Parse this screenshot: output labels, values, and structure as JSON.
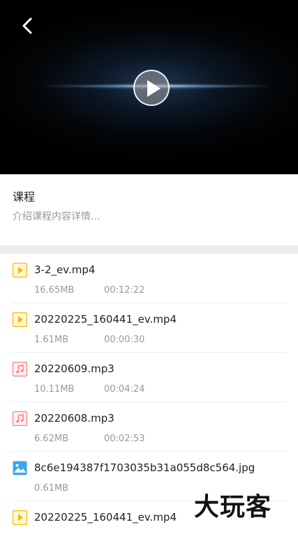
{
  "player": {
    "back_icon": "chevron-left-icon",
    "play_icon": "play-icon"
  },
  "course": {
    "title": "课程",
    "description": "介绍课程内容详情..."
  },
  "files": [
    {
      "name": "3-2_ev.mp4",
      "size": "16.65MB",
      "duration": "00:12:22",
      "icon": "video-icon"
    },
    {
      "name": "20220225_160441_ev.mp4",
      "size": "1.61MB",
      "duration": "00:00:30",
      "icon": "video-icon"
    },
    {
      "name": "20220609.mp3",
      "size": "10.11MB",
      "duration": "00:04:24",
      "icon": "music-icon"
    },
    {
      "name": "20220608.mp3",
      "size": "6.62MB",
      "duration": "00:02:53",
      "icon": "music-icon"
    },
    {
      "name": "8c6e194387f1703035b31a055d8c564.jpg",
      "size": "0.61MB",
      "duration": "",
      "icon": "image-icon"
    },
    {
      "name": "20220225_160441_ev.mp4",
      "size": "",
      "duration": "",
      "icon": "video-icon"
    }
  ],
  "watermark": "大玩客",
  "colors": {
    "video_icon": "#f5b800",
    "music_icon": "#f07a7a",
    "image_icon": "#3aa5ee",
    "divider": "#ececec"
  }
}
